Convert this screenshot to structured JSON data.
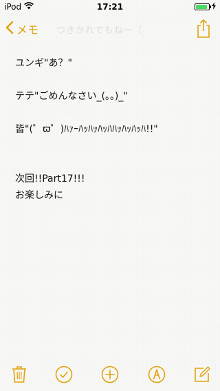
{
  "status_bar": {
    "carrier": "iPod",
    "time": "17:21",
    "battery_level": 0.9,
    "charging": true,
    "wifi_icon": "wifi-icon",
    "charging_icon": "bolt-icon"
  },
  "nav": {
    "back_label": "メモ",
    "faded_title": "つきかれでもねー（",
    "back_icon": "chevron-left-icon",
    "share_icon": "share-icon"
  },
  "note": {
    "lines": [
      "ユンギ\"あ？\"",
      "",
      "テテ\"ごめんなさい_(。。)_\"",
      "",
      "皆\"(゜ϖ゜)ﾊｧｰﾊｯﾊｯﾊｯﾊﾊｯﾊｯﾊｯﾊ!!\"",
      "",
      "",
      "次回!!Part17!!!",
      "お楽しみに"
    ]
  },
  "toolbar": {
    "icons": [
      "trash-icon",
      "checklist-icon",
      "add-icon",
      "markup-icon",
      "compose-icon"
    ]
  },
  "colors": {
    "accent": "#e1a20a",
    "battery": "#4cd964",
    "text": "#111111",
    "background": "#f8f8f6"
  }
}
